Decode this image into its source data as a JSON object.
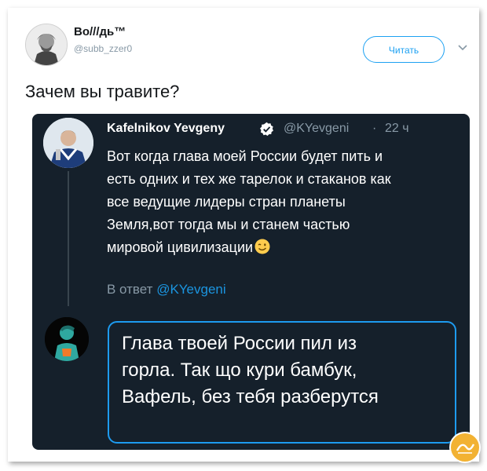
{
  "tweet": {
    "author_name": "Во///дь™",
    "author_handle": "@subb_zzer0",
    "follow_label": "Читать",
    "text": "Зачем вы травите?"
  },
  "quoted": {
    "author_name": "Kafelnikov Yevgeny",
    "author_handle": "@KYevgeni",
    "separator": "·",
    "time": "22 ч",
    "text_lines": [
      "Вот когда глава моей России будет пить и",
      "есть одних и тех же тарелок и стаканов как",
      "все ведущие лидеры стран планеты",
      "Земля,вот тогда мы и станем частью",
      "мировой цивилизации"
    ],
    "reply_prefix": "В ответ",
    "reply_handle": "@KYevgeni"
  },
  "reply": {
    "text_lines": [
      "Глава твоей России пил из",
      "горла. Так що кури бамбук,",
      "Вафель, без тебя разберутся"
    ]
  },
  "icons": {
    "verified": "verified-badge-icon",
    "chevron": "chevron-down-icon",
    "emoji": "winking-face-emoji-icon",
    "watermark": "site-logo-watermark"
  },
  "colors": {
    "accent": "#1da1f2",
    "dark_card": "#15202b",
    "muted": "#8899a6",
    "watermark": "#f2b233"
  }
}
